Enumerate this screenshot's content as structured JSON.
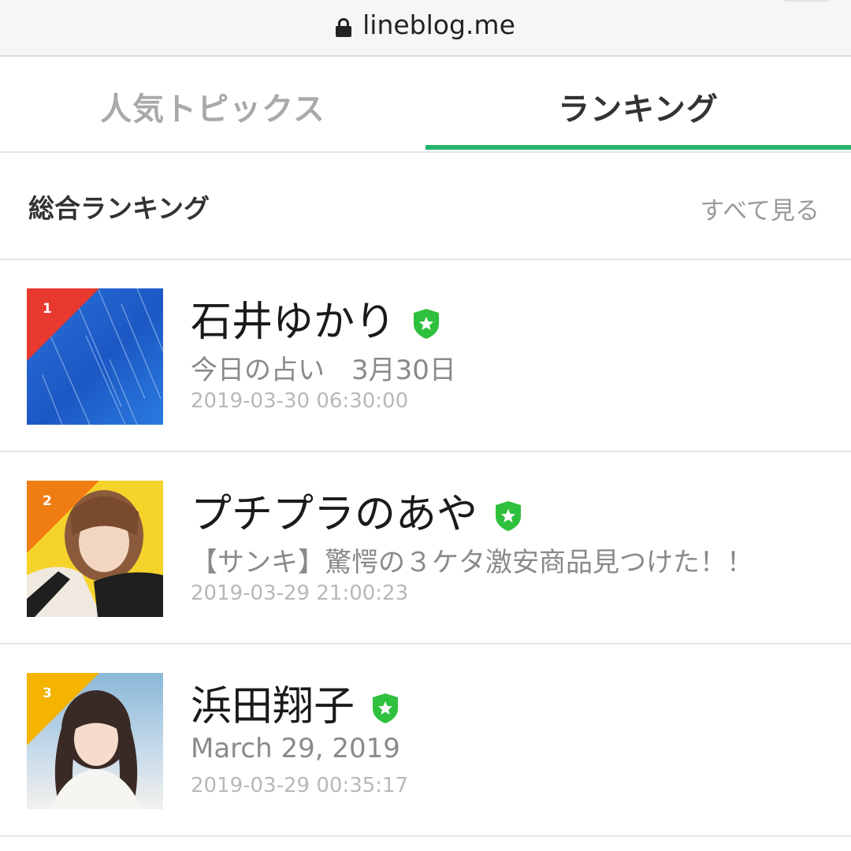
{
  "browser": {
    "url": "lineblog.me"
  },
  "tabs": [
    {
      "label": "人気トピックス",
      "active": false
    },
    {
      "label": "ランキング",
      "active": true
    }
  ],
  "section": {
    "title": "総合ランキング",
    "see_all": "すべて見る"
  },
  "ranking": [
    {
      "rank": "1",
      "name": "石井ゆかり",
      "verified": true,
      "title": "今日の占い　3月30日",
      "date": "2019-03-30 06:30:00",
      "rank_color": "#e8392f"
    },
    {
      "rank": "2",
      "name": "プチプラのあや",
      "verified": true,
      "title": "【サンキ】驚愕の３ケタ激安商品見つけた！！",
      "date": "2019-03-29 21:00:23",
      "rank_color": "#f07d14"
    },
    {
      "rank": "3",
      "name": "浜田翔子",
      "verified": true,
      "title": "March 29, 2019",
      "date": "2019-03-29 00:35:17",
      "rank_color": "#f4b400"
    }
  ],
  "colors": {
    "accent": "#27b26b",
    "verified_badge": "#2fc13d"
  }
}
